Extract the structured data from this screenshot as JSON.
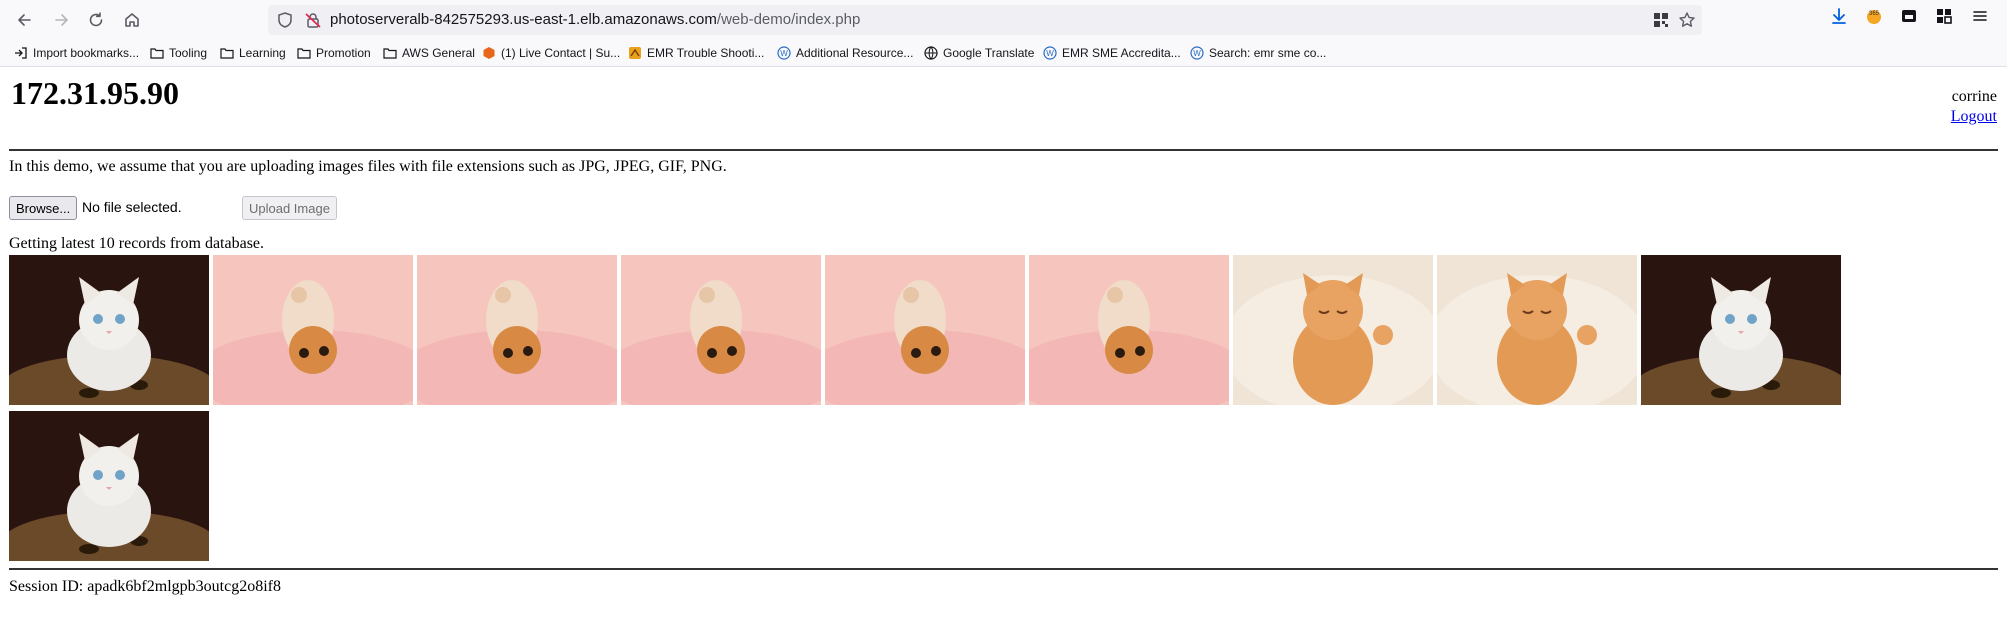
{
  "browser": {
    "url_host": "photoserveralb-842575293.us-east-1.elb.amazonaws.com",
    "url_path": "/web-demo/index.php",
    "bookmarks": [
      {
        "label": "Import bookmarks...",
        "icon": "import-icon"
      },
      {
        "label": "Tooling",
        "icon": "folder-icon"
      },
      {
        "label": "Learning",
        "icon": "folder-icon"
      },
      {
        "label": "Promotion",
        "icon": "folder-icon"
      },
      {
        "label": "AWS General",
        "icon": "folder-icon"
      },
      {
        "label": "(1) Live Contact | Su...",
        "icon": "hex-orange-icon"
      },
      {
        "label": "EMR Trouble Shooti...",
        "icon": "orange-logo-icon"
      },
      {
        "label": "Additional Resource...",
        "icon": "w-icon"
      },
      {
        "label": "Google Translate",
        "icon": "globe-icon"
      },
      {
        "label": "EMR SME Accredita...",
        "icon": "w-icon"
      },
      {
        "label": "Search: emr sme co...",
        "icon": "w-icon"
      }
    ]
  },
  "page": {
    "server_ip": "172.31.95.90",
    "username": "corrine",
    "logout_label": "Logout",
    "intro": "In this demo, we assume that you are uploading images files with file extensions such as JPG, JPEG, GIF, PNG.",
    "browse_label": "Browse...",
    "file_status": "No file selected.",
    "upload_label": "Upload Image",
    "records_text": "Getting latest 10 records from database.",
    "images": [
      {
        "subject": "white-kitten-on-leopard-blanket"
      },
      {
        "subject": "ginger-kitten-on-pink-blanket"
      },
      {
        "subject": "ginger-kitten-on-pink-blanket"
      },
      {
        "subject": "ginger-kitten-on-pink-blanket"
      },
      {
        "subject": "ginger-kitten-on-pink-blanket"
      },
      {
        "subject": "ginger-kitten-on-pink-blanket"
      },
      {
        "subject": "sleeping-ginger-kitten-on-fur"
      },
      {
        "subject": "sleeping-ginger-kitten-on-fur"
      },
      {
        "subject": "white-kitten-on-leopard-blanket"
      },
      {
        "subject": "white-kitten-on-leopard-blanket"
      }
    ],
    "session_text": "Session ID: apadk6bf2mlgpb3outcg2o8if8"
  }
}
